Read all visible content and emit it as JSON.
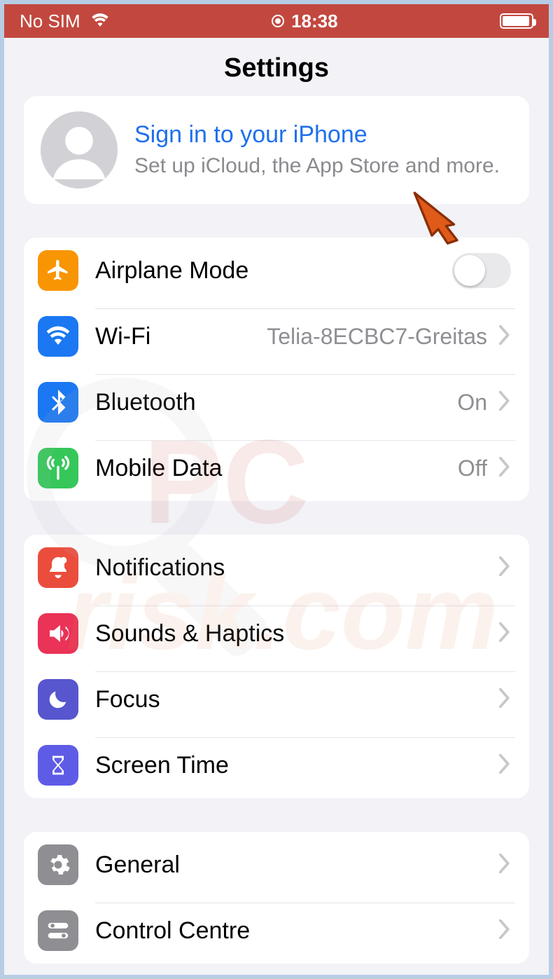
{
  "status": {
    "carrier": "No SIM",
    "time": "18:38"
  },
  "title": "Settings",
  "signin": {
    "title": "Sign in to your iPhone",
    "subtitle": "Set up iCloud, the App Store and more."
  },
  "groups": [
    {
      "rows": [
        {
          "icon": "airplane-icon",
          "color": "bg-orange",
          "label": "Airplane Mode",
          "control": "switch",
          "switch_on": false
        },
        {
          "icon": "wifi-icon",
          "color": "bg-blue",
          "label": "Wi-Fi",
          "value": "Telia-8ECBC7-Greitas",
          "chevron": true
        },
        {
          "icon": "bluetooth-icon",
          "color": "bg-blue",
          "label": "Bluetooth",
          "value": "On",
          "chevron": true
        },
        {
          "icon": "cellular-icon",
          "color": "bg-green",
          "label": "Mobile Data",
          "value": "Off",
          "chevron": true
        }
      ]
    },
    {
      "rows": [
        {
          "icon": "bell-icon",
          "color": "bg-red",
          "label": "Notifications",
          "chevron": true
        },
        {
          "icon": "speaker-icon",
          "color": "bg-pink",
          "label": "Sounds & Haptics",
          "chevron": true
        },
        {
          "icon": "moon-icon",
          "color": "bg-indigo",
          "label": "Focus",
          "chevron": true
        },
        {
          "icon": "hourglass-icon",
          "color": "bg-purple",
          "label": "Screen Time",
          "chevron": true
        }
      ]
    },
    {
      "rows": [
        {
          "icon": "gear-icon",
          "color": "bg-gray",
          "label": "General",
          "chevron": true
        },
        {
          "icon": "switches-icon",
          "color": "bg-gray",
          "label": "Control Centre",
          "chevron": true
        }
      ]
    }
  ],
  "accent_link": "#1f6fed",
  "annotation_arrow_color": "#e05a1a"
}
